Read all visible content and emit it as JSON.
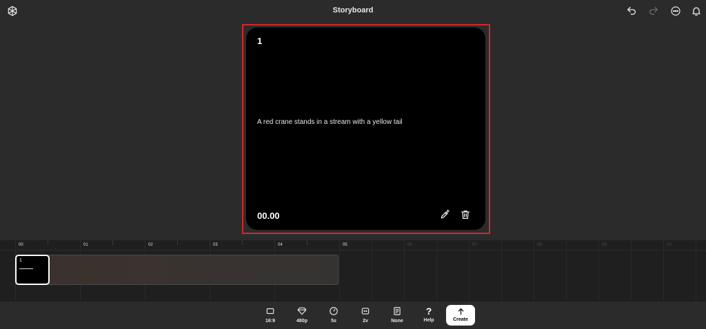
{
  "header": {
    "title": "Storyboard",
    "icons": [
      "openai-logo-icon",
      "undo-icon",
      "redo-icon",
      "more-options-icon",
      "notification-bell-icon"
    ]
  },
  "card": {
    "number": "1",
    "description": "A red crane stands in a stream with a yellow tail",
    "time": "00.00",
    "highlight_color": "#d8262b"
  },
  "timeline": {
    "ticks": [
      "00",
      "01",
      "02",
      "03",
      "04",
      "05",
      "06",
      "07",
      "08",
      "09",
      "10"
    ],
    "clip": {
      "number": "1"
    }
  },
  "toolbar": {
    "aspect": "16:9",
    "resolution": "480p",
    "duration": "5s",
    "variations": "2v",
    "preset": "None",
    "help": "Help",
    "create": "Create"
  }
}
